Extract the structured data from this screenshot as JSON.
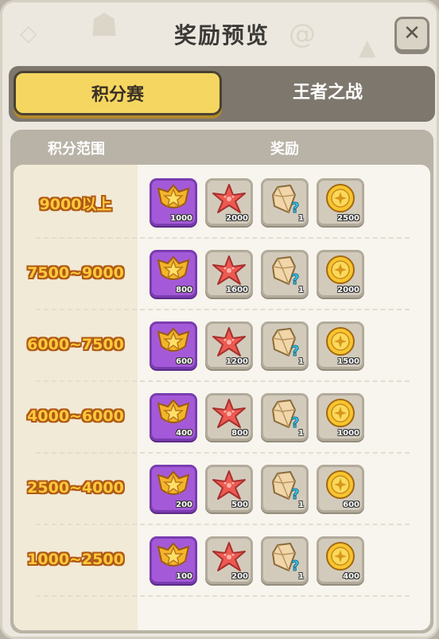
{
  "dialog": {
    "title": "奖励预览",
    "close_icon": "close-icon"
  },
  "tabs": [
    {
      "label": "积分赛",
      "active": true
    },
    {
      "label": "王者之战",
      "active": false
    }
  ],
  "table": {
    "headers": {
      "range": "积分范围",
      "reward": "奖励"
    },
    "rows": [
      {
        "range": "9000以上",
        "rewards": [
          {
            "icon": "star-badge-icon",
            "qty": "1000"
          },
          {
            "icon": "starfish-icon",
            "qty": "2000"
          },
          {
            "icon": "mystery-crystal-icon",
            "qty": "1"
          },
          {
            "icon": "gold-coin-icon",
            "qty": "2500"
          }
        ]
      },
      {
        "range": "7500~9000",
        "rewards": [
          {
            "icon": "star-badge-icon",
            "qty": "800"
          },
          {
            "icon": "starfish-icon",
            "qty": "1600"
          },
          {
            "icon": "mystery-crystal-icon",
            "qty": "1"
          },
          {
            "icon": "gold-coin-icon",
            "qty": "2000"
          }
        ]
      },
      {
        "range": "6000~7500",
        "rewards": [
          {
            "icon": "star-badge-icon",
            "qty": "600"
          },
          {
            "icon": "starfish-icon",
            "qty": "1200"
          },
          {
            "icon": "mystery-crystal-icon",
            "qty": "1"
          },
          {
            "icon": "gold-coin-icon",
            "qty": "1500"
          }
        ]
      },
      {
        "range": "4000~6000",
        "rewards": [
          {
            "icon": "star-badge-icon",
            "qty": "400"
          },
          {
            "icon": "starfish-icon",
            "qty": "800"
          },
          {
            "icon": "mystery-crystal-icon",
            "qty": "1"
          },
          {
            "icon": "gold-coin-icon",
            "qty": "1000"
          }
        ]
      },
      {
        "range": "2500~4000",
        "rewards": [
          {
            "icon": "star-badge-icon",
            "qty": "200"
          },
          {
            "icon": "starfish-icon",
            "qty": "500"
          },
          {
            "icon": "mystery-crystal-icon",
            "qty": "1"
          },
          {
            "icon": "gold-coin-icon",
            "qty": "600"
          }
        ]
      },
      {
        "range": "1000~2500",
        "rewards": [
          {
            "icon": "star-badge-icon",
            "qty": "100"
          },
          {
            "icon": "starfish-icon",
            "qty": "200"
          },
          {
            "icon": "mystery-crystal-icon",
            "qty": "1"
          },
          {
            "icon": "gold-coin-icon",
            "qty": "400"
          }
        ]
      }
    ]
  }
}
